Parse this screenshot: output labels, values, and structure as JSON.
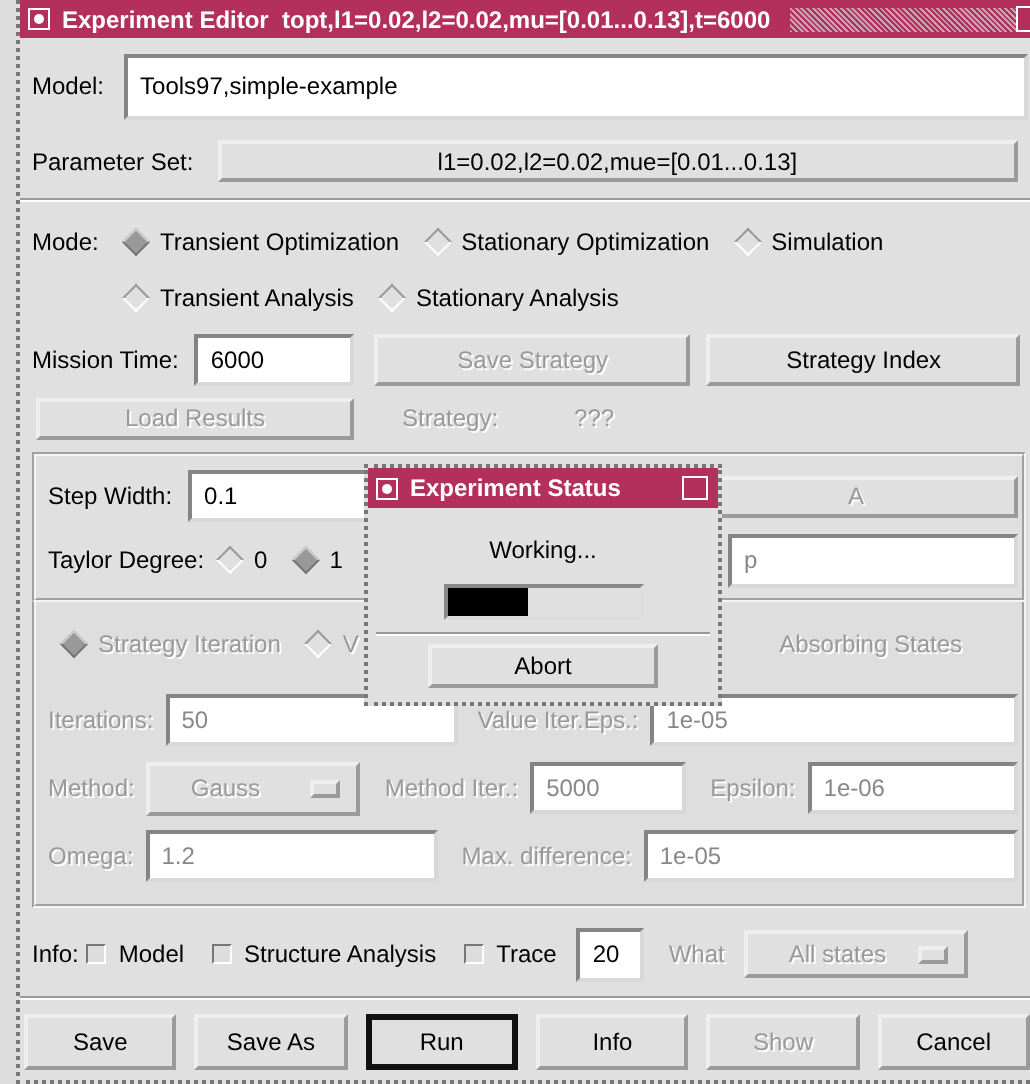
{
  "window": {
    "title": "Experiment Editor  topt,l1=0.02,l2=0.02,mu=[0.01...0.13],t=6000"
  },
  "model": {
    "label": "Model:",
    "value": "Tools97,simple-example"
  },
  "parameter_set": {
    "label": "Parameter Set:",
    "value": "l1=0.02,l2=0.02,mue=[0.01...0.13]"
  },
  "mode": {
    "label": "Mode:",
    "rows": [
      [
        {
          "label": "Transient Optimization",
          "selected": true
        },
        {
          "label": "Stationary Optimization",
          "selected": false
        },
        {
          "label": "Simulation",
          "selected": false
        }
      ],
      [
        {
          "label": "Transient Analysis",
          "selected": false
        },
        {
          "label": "Stationary Analysis",
          "selected": false
        }
      ]
    ]
  },
  "mission_time": {
    "label": "Mission Time:",
    "value": "6000"
  },
  "strategy_buttons": [
    {
      "label": "Save Strategy",
      "disabled": true
    },
    {
      "label": "Strategy Index",
      "disabled": false
    }
  ],
  "load_results": {
    "label": "Load Results",
    "disabled": true
  },
  "strategy": {
    "label": "Strategy:",
    "value": "???",
    "disabled": true
  },
  "transient_panel": {
    "step_width": {
      "label": "Step Width:",
      "value": "0.1"
    },
    "taylor_degree": {
      "label": "Taylor Degree:",
      "options": [
        {
          "label": "0",
          "selected": false
        },
        {
          "label": "1",
          "selected": true
        }
      ]
    },
    "right_button": {
      "label": "A",
      "disabled": true
    },
    "right_field": {
      "value": "p",
      "disabled": true
    }
  },
  "stationary_panel": {
    "disabled": true,
    "methods": [
      {
        "label": "Strategy Iteration",
        "selected": true
      },
      {
        "label": "V",
        "selected": false
      }
    ],
    "absorbing_states": "Absorbing States",
    "rows": [
      [
        {
          "kind": "field",
          "label": "Iterations:",
          "value": "50"
        },
        {
          "kind": "field",
          "label": "Value Iter.Eps.:",
          "value": "1e-05"
        }
      ],
      [
        {
          "kind": "dropdown",
          "label": "Method:",
          "value": "Gauss"
        },
        {
          "kind": "field",
          "label": "Method Iter.:",
          "value": "5000"
        },
        {
          "kind": "field",
          "label": "Epsilon:",
          "value": "1e-06"
        }
      ],
      [
        {
          "kind": "field",
          "label": "Omega:",
          "value": "1.2"
        },
        {
          "kind": "field",
          "label": "Max. difference:",
          "value": "1e-05"
        }
      ]
    ]
  },
  "info": {
    "label": "Info:",
    "checkboxes": [
      {
        "label": "Model",
        "checked": false
      },
      {
        "label": "Structure Analysis",
        "checked": false
      },
      {
        "label": "Trace",
        "checked": false
      }
    ],
    "trace_value": "20",
    "what": {
      "label": "What",
      "value": "All states",
      "disabled": true
    }
  },
  "buttons": [
    {
      "label": "Save",
      "disabled": false,
      "default": false
    },
    {
      "label": "Save As",
      "disabled": false,
      "default": false
    },
    {
      "label": "Run",
      "disabled": false,
      "default": true
    },
    {
      "label": "Info",
      "disabled": false,
      "default": false
    },
    {
      "label": "Show",
      "disabled": true,
      "default": false
    },
    {
      "label": "Cancel",
      "disabled": false,
      "default": false
    }
  ],
  "status_dialog": {
    "title": "Experiment Status",
    "message": "Working...",
    "level": 0.42,
    "button": "Abort"
  }
}
